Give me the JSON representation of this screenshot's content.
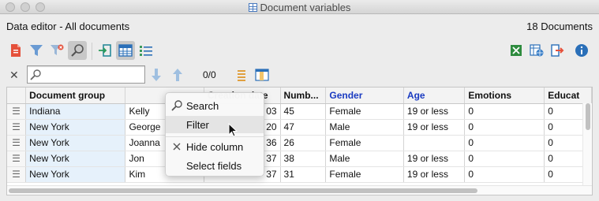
{
  "window": {
    "title": "Document variables",
    "controls": [
      "close-button",
      "minimize-button",
      "zoom-button"
    ]
  },
  "header": {
    "title": "Data editor - All documents",
    "document_count": "18 Documents"
  },
  "toolbar": {
    "icons": [
      "document-icon",
      "filter-icon",
      "clear-filter-icon",
      "search-icon",
      "import-icon",
      "table-view-icon",
      "list-view-icon",
      "excel-export-icon",
      "html-export-icon",
      "export-icon",
      "info-icon"
    ],
    "active": [
      "search-icon",
      "table-view-icon"
    ]
  },
  "searchbar": {
    "value": "",
    "placeholder": "",
    "counter": "0/0"
  },
  "table": {
    "columns": [
      "",
      "Document group",
      "",
      "Creation date",
      "Numb...",
      "Gender",
      "Age",
      "Emotions",
      "Educat"
    ],
    "highlighted_columns": [
      "Gender",
      "Age"
    ],
    "rows": [
      [
        "Indiana",
        "Kelly",
        "03",
        "45",
        "Female",
        "19 or less",
        "0",
        "0"
      ],
      [
        "New York",
        "George",
        "20",
        "47",
        "Male",
        "19 or less",
        "0",
        "0"
      ],
      [
        "New York",
        "Joanna",
        "36",
        "26",
        "Female",
        "",
        "0",
        "0"
      ],
      [
        "New York",
        "Jon",
        "37",
        "38",
        "Male",
        "19 or less",
        "0",
        "0"
      ],
      [
        "New York",
        "Kim",
        "37",
        "31",
        "Female",
        "19 or less",
        "0",
        "0"
      ]
    ]
  },
  "context_menu": {
    "items": [
      {
        "label": "Search",
        "icon": "search-icon"
      },
      {
        "label": "Filter",
        "icon": ""
      },
      {
        "label": "Hide column",
        "icon": "close-icon"
      },
      {
        "label": "Select fields",
        "icon": ""
      }
    ],
    "hovered": "Filter"
  },
  "colors": {
    "accent_blue": "#1a3bc1",
    "group_cell_bg": "#e6f1fb",
    "menu_hover": "#e4e4e4"
  }
}
